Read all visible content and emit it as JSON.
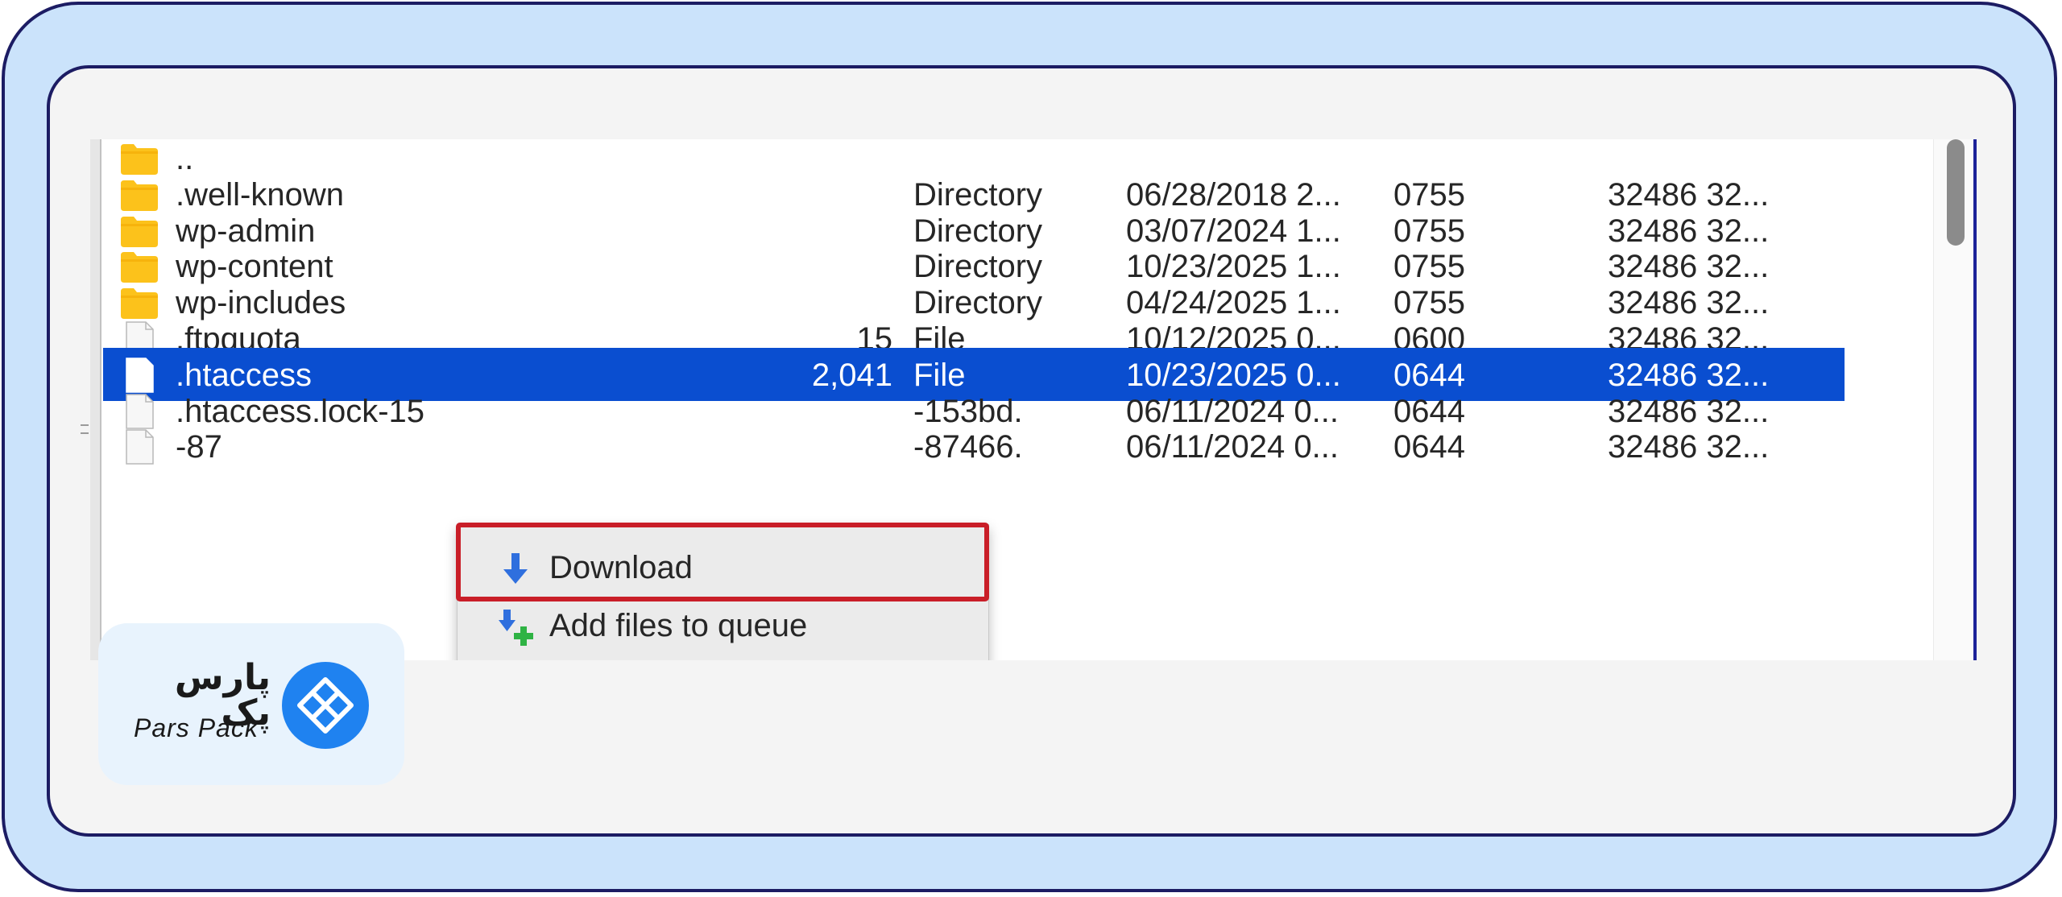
{
  "colors": {
    "frame_bg": "#cbe3fb",
    "frame_border": "#1c1c63",
    "card_bg": "#f4f4f4",
    "selection": "#0a4ed0",
    "folder": "#fcc21b",
    "highlight_border": "#c91e28",
    "download_arrow": "#2f6fde",
    "queue_plus": "#2fb344",
    "brand_blue": "#1f82f0"
  },
  "file_list": {
    "rows": [
      {
        "icon": "folder-icon",
        "name": "..",
        "size": "",
        "type": "",
        "date": "",
        "perm": "",
        "owner": ""
      },
      {
        "icon": "folder-icon",
        "name": ".well-known",
        "size": "",
        "type": "Directory",
        "date": "06/28/2018 2...",
        "perm": "0755",
        "owner": "32486 32..."
      },
      {
        "icon": "folder-icon",
        "name": "wp-admin",
        "size": "",
        "type": "Directory",
        "date": "03/07/2024 1...",
        "perm": "0755",
        "owner": "32486 32..."
      },
      {
        "icon": "folder-icon",
        "name": "wp-content",
        "size": "",
        "type": "Directory",
        "date": "10/23/2025 1...",
        "perm": "0755",
        "owner": "32486 32..."
      },
      {
        "icon": "folder-icon",
        "name": "wp-includes",
        "size": "",
        "type": "Directory",
        "date": "04/24/2025 1...",
        "perm": "0755",
        "owner": "32486 32..."
      },
      {
        "icon": "file-icon",
        "name": ".ftpquota",
        "size": "15",
        "type": "File",
        "date": "10/12/2025 0...",
        "perm": "0600",
        "owner": "32486 32..."
      },
      {
        "icon": "file-icon",
        "name": ".htaccess",
        "size": "2,041",
        "type": "File",
        "date": "10/23/2025 0...",
        "perm": "0644",
        "owner": "32486 32...",
        "selected": true
      },
      {
        "icon": "file-icon",
        "name": ".htaccess.lock-15",
        "size": "",
        "type": "-153bd.",
        "date": "06/11/2024 0...",
        "perm": "0644",
        "owner": "32486 32..."
      },
      {
        "icon": "file-icon",
        "name": "-87",
        "size": "",
        "type": "-87466.",
        "date": "06/11/2024 0...",
        "perm": "0644",
        "owner": "32486 32..."
      }
    ]
  },
  "context_menu": {
    "items": [
      {
        "label": "Download",
        "icon": "download-arrow-icon"
      },
      {
        "label": "Add files to queue",
        "icon": "add-to-queue-icon"
      }
    ]
  },
  "brand": {
    "name_fa": "پارس پک",
    "name_en": "Pars Pack",
    "logo": "diamond-lattice-logo"
  }
}
